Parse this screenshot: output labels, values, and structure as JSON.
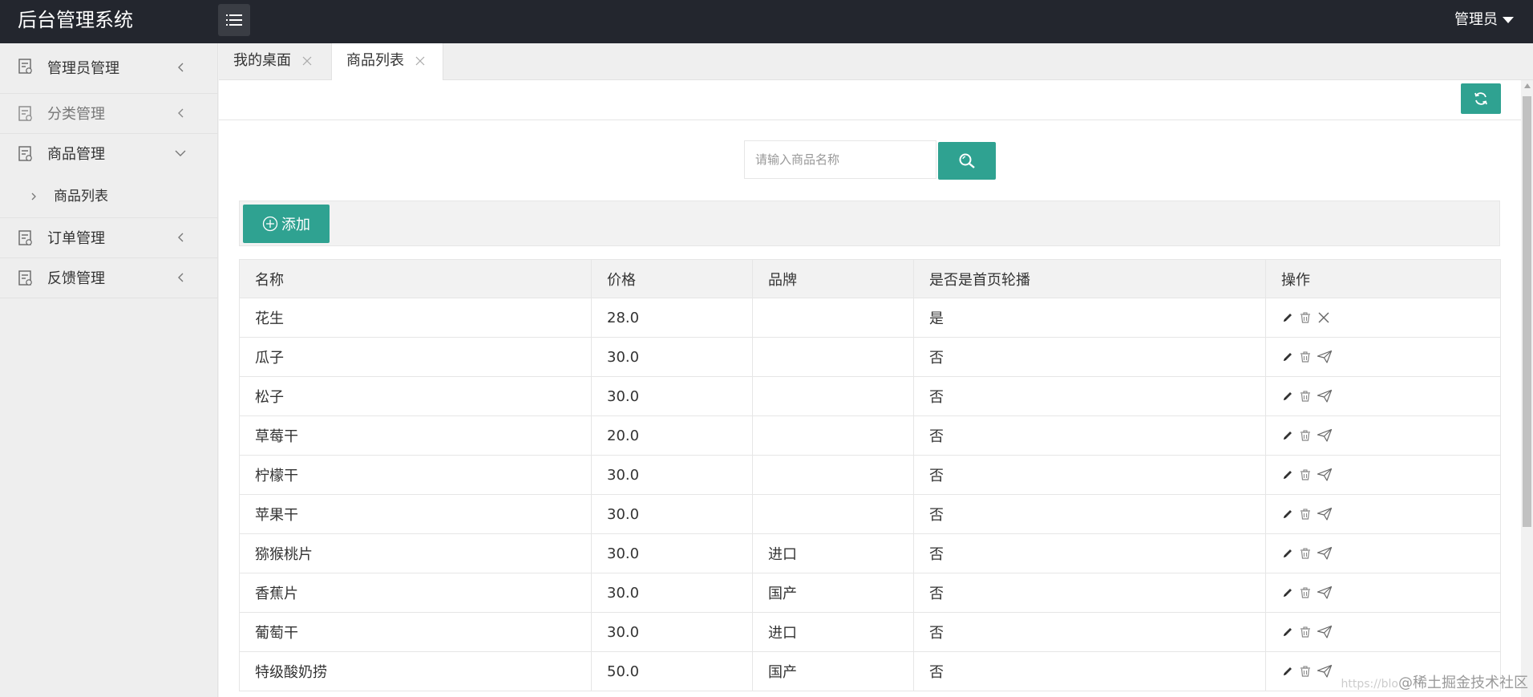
{
  "header": {
    "logo": "后台管理系统",
    "menu_icon": "menu-list-icon",
    "user_label": "管理员"
  },
  "sidebar": {
    "items": [
      {
        "label": "管理员管理",
        "icon": "doc-icon",
        "expanded": false
      },
      {
        "label": "分类管理",
        "icon": "doc-icon",
        "expanded": false
      },
      {
        "label": "商品管理",
        "icon": "doc-icon",
        "expanded": true,
        "children": [
          {
            "label": "商品列表"
          }
        ]
      },
      {
        "label": "订单管理",
        "icon": "doc-icon",
        "expanded": false
      },
      {
        "label": "反馈管理",
        "icon": "doc-icon",
        "expanded": false
      }
    ]
  },
  "tabs": [
    {
      "label": "我的桌面",
      "active": false
    },
    {
      "label": "商品列表",
      "active": true
    }
  ],
  "search": {
    "placeholder": "请输入商品名称",
    "value": ""
  },
  "actions": {
    "add_label": "添加"
  },
  "table": {
    "columns": [
      "名称",
      "价格",
      "品牌",
      "是否是首页轮播",
      "操作"
    ],
    "rows": [
      {
        "name": "花生",
        "price": "28.0",
        "brand": "",
        "carousel": "是",
        "third_action": "close-icon"
      },
      {
        "name": "瓜子",
        "price": "30.0",
        "brand": "",
        "carousel": "否",
        "third_action": "send-icon"
      },
      {
        "name": "松子",
        "price": "30.0",
        "brand": "",
        "carousel": "否",
        "third_action": "send-icon"
      },
      {
        "name": "草莓干",
        "price": "20.0",
        "brand": "",
        "carousel": "否",
        "third_action": "send-icon"
      },
      {
        "name": "柠檬干",
        "price": "30.0",
        "brand": "",
        "carousel": "否",
        "third_action": "send-icon"
      },
      {
        "name": "苹果干",
        "price": "30.0",
        "brand": "",
        "carousel": "否",
        "third_action": "send-icon"
      },
      {
        "name": "猕猴桃片",
        "price": "30.0",
        "brand": "进口",
        "carousel": "否",
        "third_action": "send-icon"
      },
      {
        "name": "香蕉片",
        "price": "30.0",
        "brand": "国产",
        "carousel": "否",
        "third_action": "send-icon"
      },
      {
        "name": "葡萄干",
        "price": "30.0",
        "brand": "进口",
        "carousel": "否",
        "third_action": "send-icon"
      },
      {
        "name": "特级酸奶捞",
        "price": "50.0",
        "brand": "国产",
        "carousel": "否",
        "third_action": "send-icon"
      }
    ]
  },
  "watermark": {
    "text": "@稀土掘金技术社区",
    "faint": "https://blo"
  },
  "colors": {
    "header_bg": "#23262e",
    "accent": "#2fa291",
    "sidebar_bg": "#eeeeee"
  }
}
